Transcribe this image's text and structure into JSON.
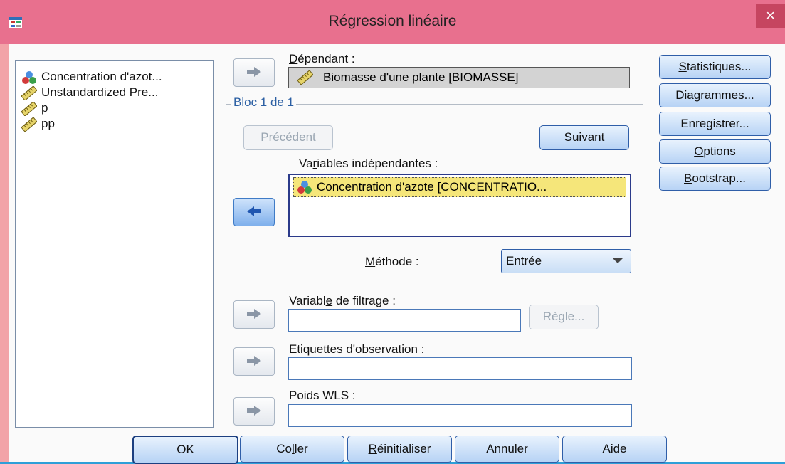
{
  "window": {
    "title": "Régression linéaire",
    "close_glyph": "×"
  },
  "variable_list": {
    "items": [
      {
        "label": "Concentration d'azot...",
        "icon": "nominal-variable-icon"
      },
      {
        "label": "Unstandardized Pre...",
        "icon": "scale-variable-icon"
      },
      {
        "label": "p",
        "icon": "scale-variable-icon"
      },
      {
        "label": "pp",
        "icon": "scale-variable-icon"
      }
    ]
  },
  "dependent": {
    "label": "Dépendant :",
    "value": "Biomasse d'une plante [BIOMASSE]"
  },
  "block": {
    "label": "Bloc 1 de 1",
    "previous": "Précédent",
    "next": "Suivant"
  },
  "independents": {
    "label": "Variables indépendantes :",
    "items": [
      "Concentration d'azote [CONCENTRATIO..."
    ]
  },
  "method": {
    "label": "Méthode :",
    "value": "Entrée"
  },
  "filter": {
    "label": "Variable de filtrage :",
    "value": "",
    "rule_button": "Règle..."
  },
  "case_labels": {
    "label": "Etiquettes d'observation :",
    "value": ""
  },
  "wls": {
    "label": "Poids WLS :",
    "value": ""
  },
  "side_buttons": {
    "statistics": "Statistiques...",
    "plots": "Diagrammes...",
    "save": "Enregistrer...",
    "options": "Options",
    "bootstrap": "Bootstrap..."
  },
  "bottom_buttons": {
    "ok": "OK",
    "paste": "Coller",
    "reset": "Réinitialiser",
    "cancel": "Annuler",
    "help": "Aide"
  },
  "colors": {
    "titlebar": "#e8708e",
    "dialog_background": "#f2a3a8",
    "selection": "#f5e67a",
    "group_label": "#2b5fa3"
  }
}
